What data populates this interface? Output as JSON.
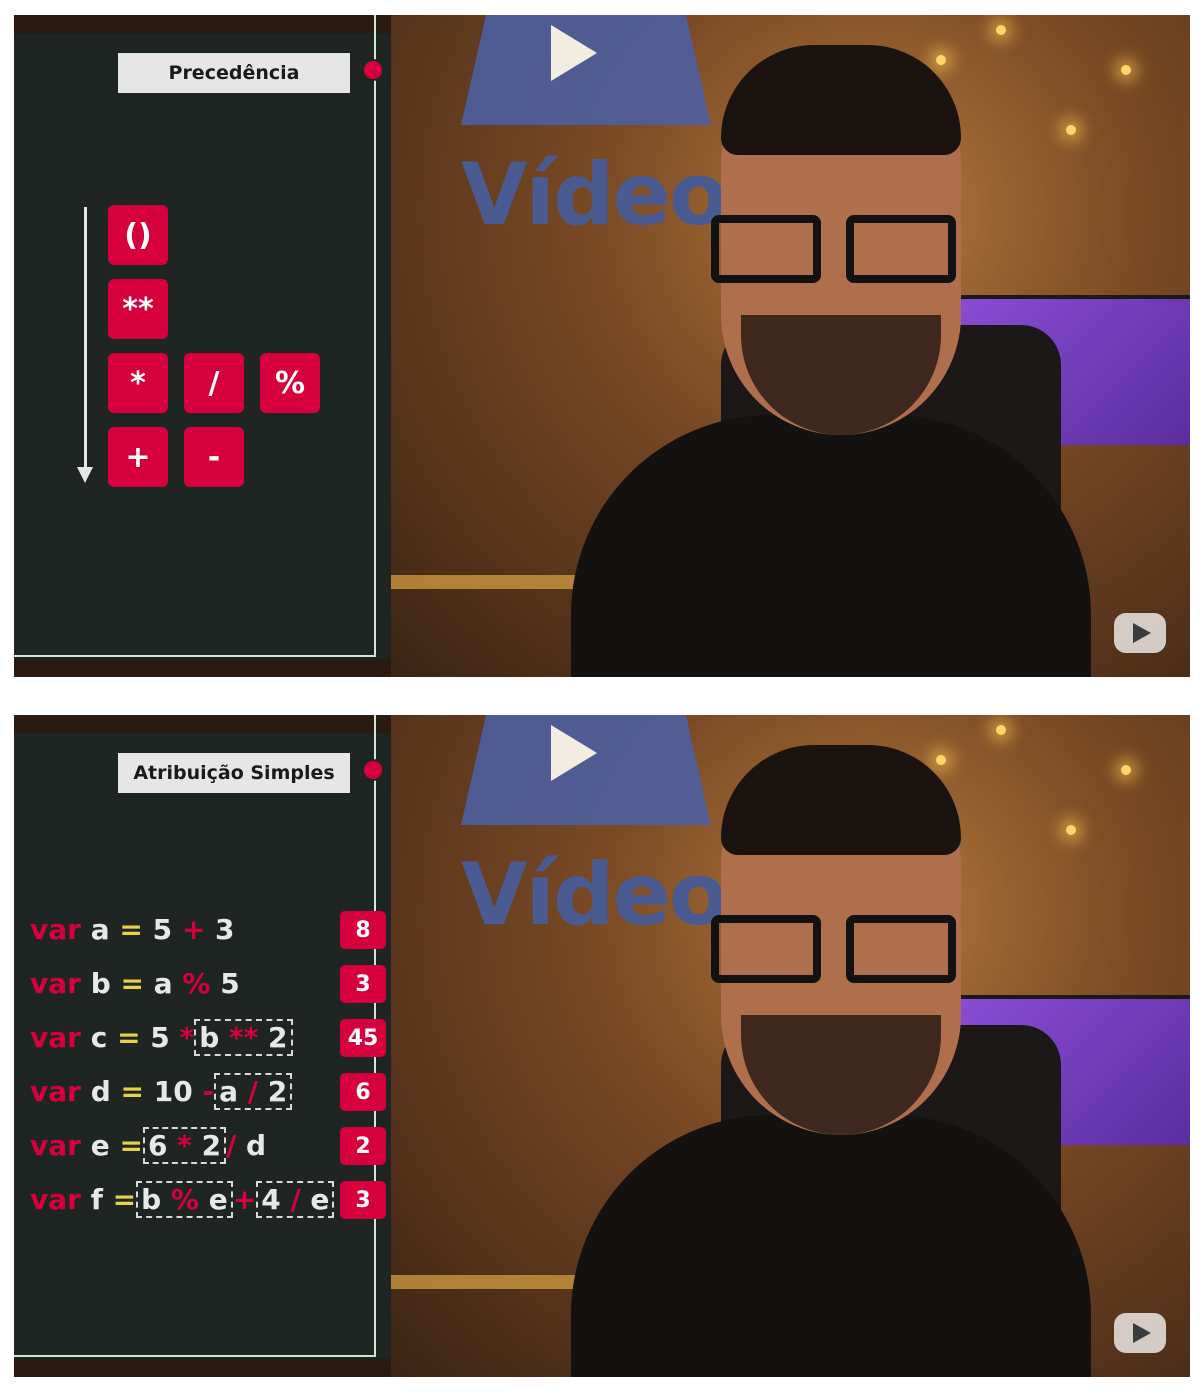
{
  "frame1": {
    "tag": "Precedência",
    "operators": [
      "()",
      "**",
      "*",
      "/",
      "%",
      "+",
      "-"
    ]
  },
  "frame2": {
    "tag": "Atribuição Simples",
    "lines": [
      {
        "kw": "var",
        "a": "a",
        "eq": "=",
        "p1": "5",
        "o1": "+",
        "p2": "3",
        "result": "8"
      },
      {
        "kw": "var",
        "a": "b",
        "eq": "=",
        "p1": "a",
        "o1": "%",
        "p2": "5",
        "result": "3"
      },
      {
        "kw": "var",
        "a": "c",
        "eq": "=",
        "p1": "5",
        "o1": "*",
        "b1": "b",
        "bo": "**",
        "b2": "2",
        "result": "45"
      },
      {
        "kw": "var",
        "a": "d",
        "eq": "=",
        "p1": "10",
        "o1": "-",
        "b1": "a",
        "bo": "/",
        "b2": "2",
        "result": "6"
      },
      {
        "kw": "var",
        "a": "e",
        "eq": "=",
        "b1": "6",
        "bo": "*",
        "b2": "2",
        "o1": "/",
        "p2": "d",
        "result": "2"
      },
      {
        "kw": "var",
        "a": "f",
        "eq": "=",
        "b1": "b",
        "bo": "%",
        "b2": "e",
        "o1": "+",
        "c1": "4",
        "co": "/",
        "c2": "e",
        "result": "3"
      }
    ]
  },
  "scene": {
    "logo_text": "Vídeo"
  },
  "colors": {
    "accent": "#d6003d",
    "panel_bg": "#1f2523",
    "equals": "#e8d24a"
  }
}
